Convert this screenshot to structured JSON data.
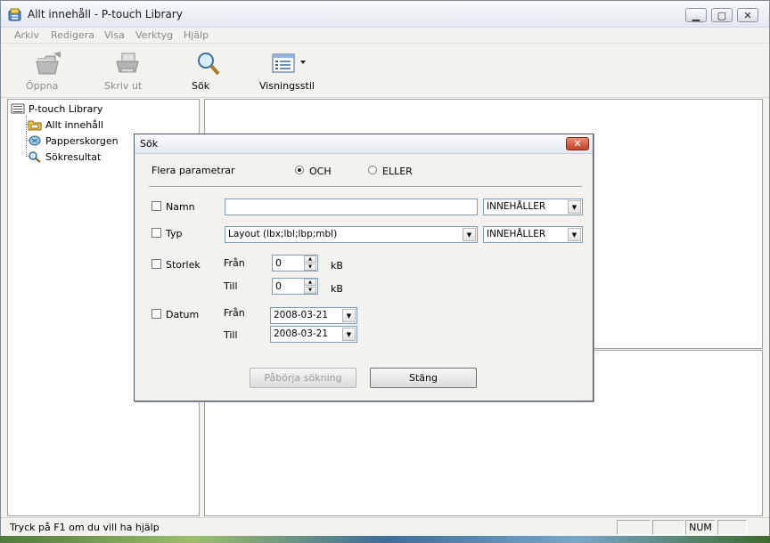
{
  "window": {
    "title": "Allt innehåll - P-touch Library"
  },
  "menu": [
    "Arkiv",
    "Redigera",
    "Visa",
    "Verktyg",
    "Hjälp"
  ],
  "toolbar": {
    "open": "Öppna",
    "print": "Skriv ut",
    "search": "Sök",
    "view_style": "Visningsstil"
  },
  "tree": {
    "root": "P-touch Library",
    "items": [
      "Allt innehåll",
      "Papperskorgen",
      "Sökresultat"
    ]
  },
  "status": {
    "help": "Tryck på F1 om du vill ha hjälp",
    "num": "NUM"
  },
  "dialog": {
    "title": "Sök",
    "close": "✕",
    "multi_params": "Flera parametrar",
    "and": "OCH",
    "or": "ELLER",
    "name_label": "Namn",
    "name_value": "",
    "name_op": "INNEHÅLLER",
    "type_label": "Typ",
    "type_value": "Layout (lbx;lbl;lbp;mbl)",
    "type_op": "INNEHÅLLER",
    "size_label": "Storlek",
    "from": "Från",
    "to": "Till",
    "size_from": "0",
    "size_to": "0",
    "unit": "kB",
    "date_label": "Datum",
    "date_from": "2008-03-21",
    "date_to": "2008-03-21",
    "start_button": "Påbörja sökning",
    "close_button": "Stäng"
  }
}
